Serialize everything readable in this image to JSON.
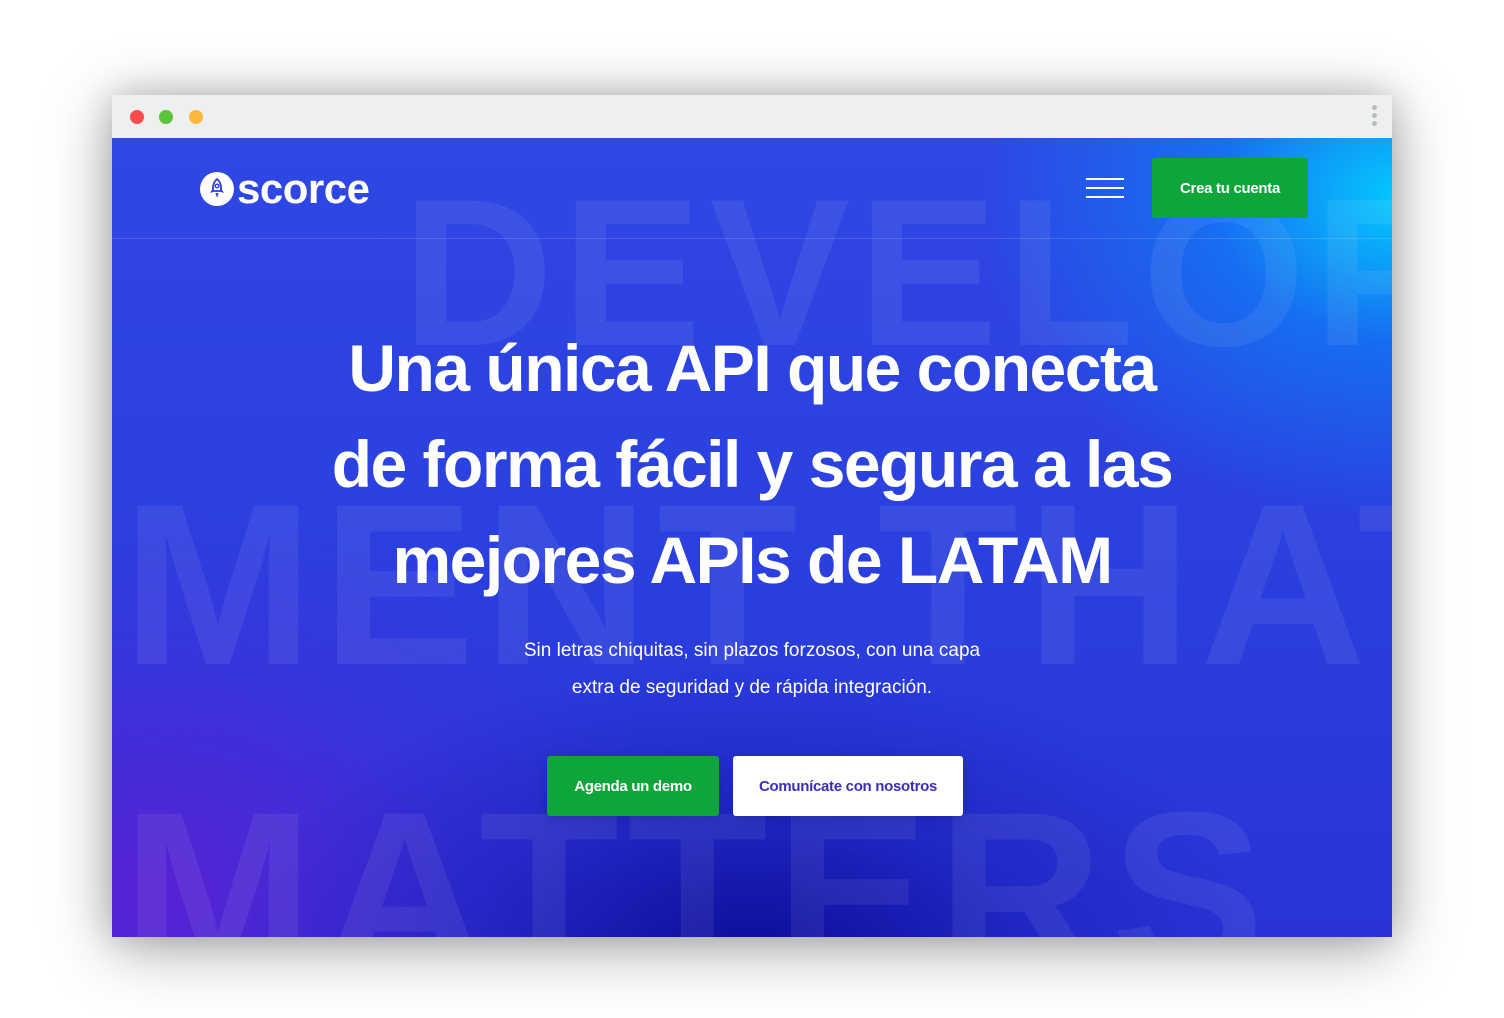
{
  "browser": {
    "window_controls": [
      "close",
      "minimize",
      "maximize"
    ],
    "menu_icon": "kebab-menu-icon"
  },
  "header": {
    "logo_text": "scorce",
    "logo_icon": "rocket-icon",
    "menu_icon": "hamburger-menu-icon",
    "cta_label": "Crea tu cuenta"
  },
  "hero": {
    "background_words": [
      "DEVELOP",
      "MENT THAT",
      "MATTERS"
    ],
    "headline_lines": [
      "Una única API que conecta",
      "de forma fácil y segura a las",
      "mejores APIs de LATAM"
    ],
    "subtitle_lines": [
      "Sin letras chiquitas, sin plazos forzosos, con una capa",
      "extra de seguridad y de rápida integración."
    ],
    "primary_cta": "Agenda un demo",
    "secondary_cta": "Comunícate con nosotros"
  },
  "colors": {
    "primary_blue": "#2b3de0",
    "accent_green": "#0ea63a",
    "accent_cyan": "#00d2ff",
    "secondary_text": "#3a2fb8"
  }
}
